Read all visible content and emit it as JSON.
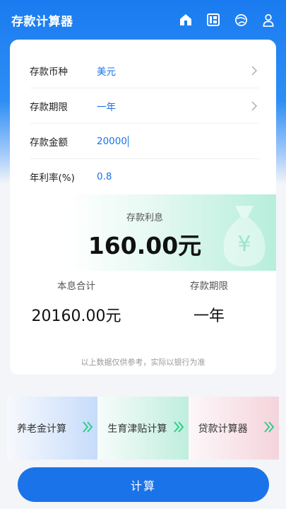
{
  "header": {
    "title": "存款计算器",
    "icons": [
      "home-icon",
      "grid-icon",
      "globe-icon",
      "user-icon"
    ]
  },
  "form": {
    "currency": {
      "label": "存款币种",
      "value": "美元"
    },
    "term": {
      "label": "存款期限",
      "value": "一年"
    },
    "amount": {
      "label": "存款金额",
      "value": "20000"
    },
    "rate": {
      "label": "年利率(%)",
      "value": "0.8"
    }
  },
  "result": {
    "interest_label": "存款利息",
    "interest_value": "160.00元",
    "total_label": "本息合计",
    "total_value": "20160.00元",
    "term_label": "存款期限",
    "term_value": "一年",
    "note": "以上数据仅供参考，实际以银行为准"
  },
  "quick_links": [
    {
      "label": "养老金计算"
    },
    {
      "label": "生育津贴计算"
    },
    {
      "label": "贷款计算器"
    }
  ],
  "calc_button": {
    "label": "计算"
  },
  "colors": {
    "primary": "#1a73e8",
    "accent_green": "#2ecf8a"
  }
}
